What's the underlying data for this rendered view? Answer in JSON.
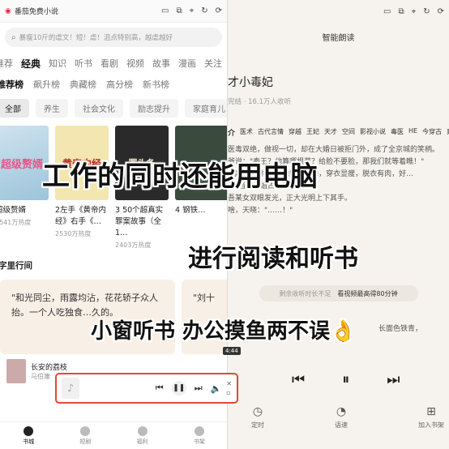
{
  "left": {
    "title": "番茄免费小说",
    "search_placeholder": "暴瘦10斤的虐文！短！虐！沮点特别高，越虐越好",
    "categories": [
      "推荐",
      "经典",
      "知识",
      "听书",
      "看剧",
      "视频",
      "故事",
      "漫画",
      "关注"
    ],
    "subtabs": [
      "推荐榜",
      "飙升榜",
      "典藏榜",
      "高分榜",
      "新书榜"
    ],
    "chips": [
      "全部",
      "养生",
      "社会文化",
      "励志提升",
      "家庭育儿"
    ],
    "books": [
      {
        "cover": "超级赘婿",
        "title": "超级赘婿",
        "meta": "2541万热度"
      },
      {
        "cover": "黄帝内经",
        "title": "2左手《黄帝内经》右手《…",
        "meta": "2530万热度"
      },
      {
        "cover": "罪头条",
        "title": "3 50个超真实罪案故事（全1…",
        "meta": "2403万热度"
      },
      {
        "cover": "",
        "title": "4 钢铁…",
        "meta": ""
      }
    ],
    "section_title": "字里行间",
    "quote_text": "\"和光同尘，雨露均沾，花花轿子众人抬。一个人吃独食…久的。",
    "quote2_text": "\"刘十",
    "author_book": "长安的荔枝",
    "author_name": "马伯庸",
    "nav": [
      "书城",
      "短剧",
      "福利",
      "书架"
    ]
  },
  "right": {
    "title": "番茄免费小说",
    "header": "智能朗读",
    "book_title": "才小毒妃",
    "book_meta": "完结 · 16.1万人收听",
    "tags": [
      "介",
      "医术",
      "古代言情",
      "穿越",
      "王妃",
      "天才",
      "空间",
      "影视小说",
      "毒医",
      "HE",
      "今穿古",
      "爽"
    ],
    "excerpt": [
      "医毒双绝，做视一切，却在大婚日被拒门外，成了全京城的笑柄。",
      "爷说：\"秦王？他算哪根葱？给脸不要脸，那我们就等着瞧！\"",
      "\"像猴子一样乘乘地贴面跳舞，穿衣显瘦，脱衣有肉，好…",
      "\"你当本小姐占你便宜。\"",
      "吾某女双眼发光，正大光明上下其手。",
      "啥，天晓：\"……！\""
    ],
    "vip_hint": "剩余收听时长不足",
    "vip_action": "看视频最高得80分钟",
    "snippet": "长面色铁青，",
    "time_badge": "4:44",
    "controls": [
      "定时",
      "语速",
      "加入书架"
    ]
  },
  "overlay": {
    "line1": "工作的同时还能用电脑",
    "line2": "进行阅读和听书",
    "line3": "小窗听书 办公摸鱼两不误👌"
  },
  "colors": {
    "player_border": "#e2492f"
  }
}
